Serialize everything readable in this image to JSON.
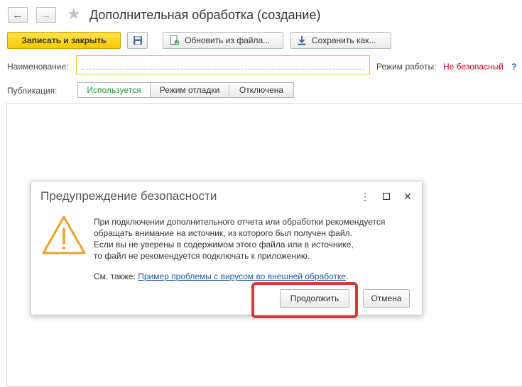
{
  "window": {
    "title": "Дополнительная обработка (создание)"
  },
  "toolbar": {
    "save_close_label": "Записать и закрыть",
    "update_from_file_label": "Обновить из файла...",
    "save_as_label": "Сохранить как..."
  },
  "form": {
    "name_label": "Наименование:",
    "name_value": "",
    "mode_label": "Режим работы:",
    "mode_value": "Не безопасный",
    "help_label": "?",
    "publication_label": "Публикация:",
    "publication_options": [
      "Используется",
      "Режим отладки",
      "Отключена"
    ],
    "publication_selected": "Используется"
  },
  "dialog": {
    "title": "Предупреждение безопасности",
    "message_lines": [
      "При подключении дополнительного отчета или обработки рекомендуется",
      "обращать внимание на источник, из которого был получен файл.",
      "Если вы не уверены в содержимом этого файла или в источнике,",
      "то файл не рекомендуется подключать к приложению."
    ],
    "see_also_prefix": "См. также: ",
    "see_also_link": "Пример проблемы с вирусом во внешней обработке",
    "see_also_suffix": ".",
    "continue_label": "Продолжить",
    "cancel_label": "Отмена"
  },
  "colors": {
    "primary_button": "#f5c900",
    "active_option": "#1a9a3c",
    "unsafe_mode": "#d0021b",
    "help": "#1f5aa6",
    "link": "#1f5aa6",
    "warning_icon": "#f0a030",
    "highlight": "#d93838"
  },
  "icons": {
    "back": "arrow-left-icon",
    "forward": "arrow-right-icon",
    "favorite": "star-icon",
    "save": "floppy-disk-icon",
    "update": "file-refresh-icon",
    "save_as": "download-icon",
    "warning": "warning-triangle-icon",
    "more": "more-vertical-icon",
    "maximize": "maximize-icon",
    "close": "close-icon"
  }
}
